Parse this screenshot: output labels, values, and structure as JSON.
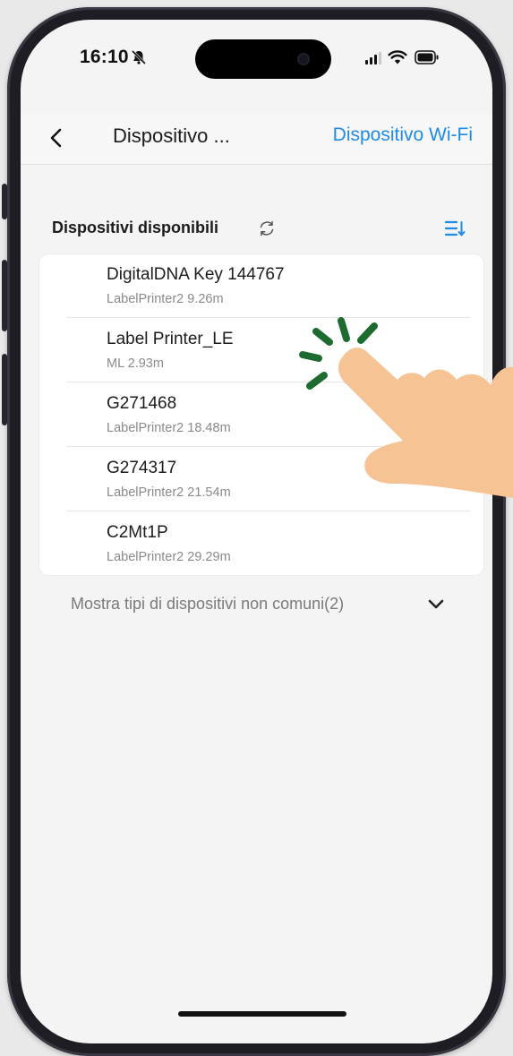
{
  "status_bar": {
    "time": "16:10"
  },
  "nav": {
    "title": "Dispositivo ...",
    "wifi_link": "Dispositivo Wi-Fi"
  },
  "section": {
    "title": "Dispositivi disponibili"
  },
  "devices": [
    {
      "name": "DigitalDNA Key 144767",
      "meta": "LabelPrinter2 9.26m"
    },
    {
      "name": "Label Printer_LE",
      "meta": "ML 2.93m"
    },
    {
      "name": "G271468",
      "meta": "LabelPrinter2 18.48m"
    },
    {
      "name": "G274317",
      "meta": "LabelPrinter2 21.54m"
    },
    {
      "name": "C2Mt1P",
      "meta": "LabelPrinter2 29.29m"
    }
  ],
  "uncommon_toggle": "Mostra tipi di dispositivi non comuni(2)",
  "colors": {
    "accent": "#1f8be5",
    "hand_skin": "#f6c395",
    "tap_burst": "#1e6b2f"
  },
  "icons": [
    "bell-muted-icon",
    "signal-icon",
    "wifi-icon",
    "battery-icon",
    "back-icon",
    "refresh-icon",
    "sort-icon",
    "chevron-down-icon",
    "pointing-hand-icon"
  ]
}
